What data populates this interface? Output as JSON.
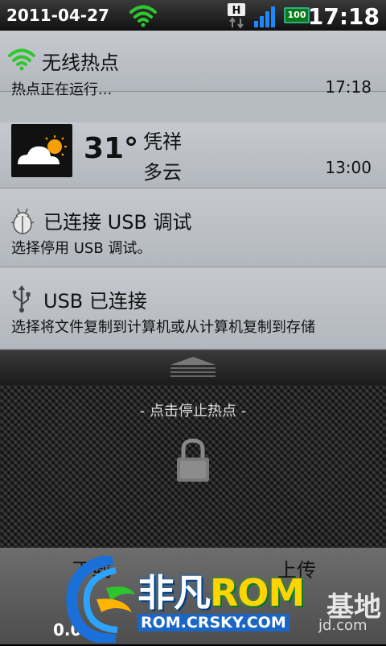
{
  "status_bar": {
    "date": "2011-04-27",
    "time": "17:18",
    "network_badge": "H",
    "battery_level": "100",
    "icons": [
      "wifi-icon",
      "h-data-icon",
      "signal-icon",
      "battery-icon"
    ]
  },
  "notifications": [
    {
      "icon": "wifi-hotspot-icon",
      "title": "无线热点",
      "subtitle": "热点正在运行...",
      "time": "17:18"
    },
    {
      "icon": "weather-partly-cloudy-icon",
      "temperature": "31°",
      "city": "凭祥",
      "condition": "多云",
      "time": "13:00"
    },
    {
      "icon": "debug-bug-icon",
      "title": "已连接 USB 调试",
      "subtitle": "选择停用 USB 调试。"
    },
    {
      "icon": "usb-icon",
      "title": "USB 已连接",
      "subtitle": "选择将文件复制到计算机或从计算机复制到存储"
    }
  ],
  "lock": {
    "stop_hotspot_label": "- 点击停止热点 -",
    "icon": "padlock-icon"
  },
  "bottom": {
    "download_label": "下载",
    "upload_label": "上传",
    "download_value": "0.0"
  },
  "watermark": {
    "brand_prefix": "非凡",
    "brand_rom": "ROM",
    "jidi": "基地",
    "url": "ROM.CRSKY.COM",
    "url_suffix": "jd.com"
  },
  "colors": {
    "notification_bg": "#b7bbc2",
    "wifi_green": "#2ec82e",
    "battery_green": "#0a7a1a"
  }
}
